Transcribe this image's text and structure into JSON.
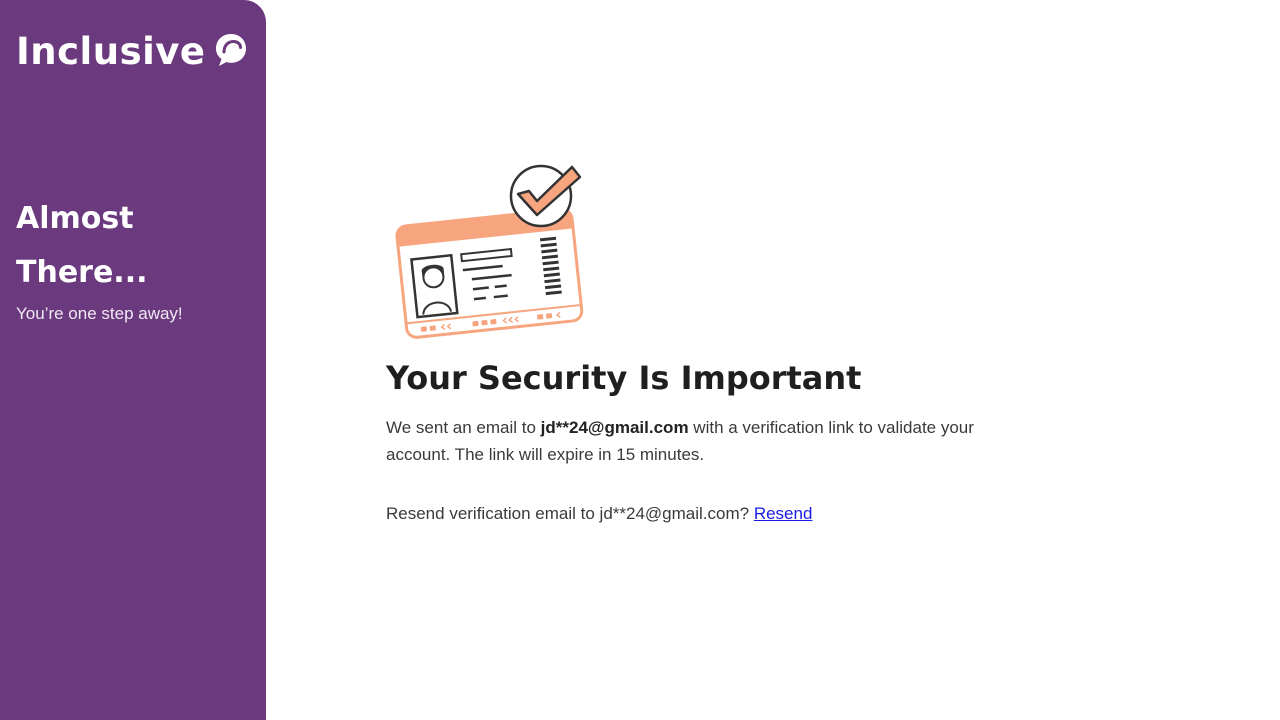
{
  "sidebar": {
    "brand_name": "Inclusive",
    "brand_icon": "chat-bubble-icon",
    "heading": "Almost There...",
    "subheading": "You’re one step away!",
    "background_color": "#6b3a7e"
  },
  "main": {
    "illustration_icon": "id-card-verified-icon",
    "title": "Your Security Is Important",
    "message": {
      "prefix": "We sent an email to ",
      "email": "jd**24@gmail.com",
      "suffix": " with a verification link to validate your account. The link will expire in 15 minutes."
    },
    "resend": {
      "prompt": "Resend verification email to jd**24@gmail.com? ",
      "link_label": "Resend"
    }
  },
  "colors": {
    "accent": "#f6a57f",
    "link": "#1a1ae6"
  }
}
